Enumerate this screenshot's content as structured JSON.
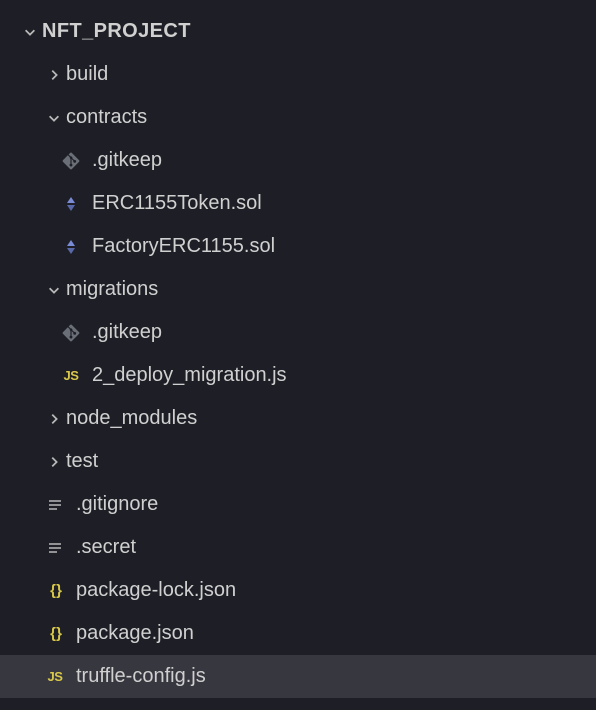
{
  "project": {
    "name": "NFT_PROJECT"
  },
  "tree": {
    "build": "build",
    "contracts": "contracts",
    "contracts_children": {
      "gitkeep": ".gitkeep",
      "erc1155": "ERC1155Token.sol",
      "factory": "FactoryERC1155.sol"
    },
    "migrations": "migrations",
    "migrations_children": {
      "gitkeep": ".gitkeep",
      "deploy": "2_deploy_migration.js"
    },
    "node_modules": "node_modules",
    "test": "test",
    "gitignore": ".gitignore",
    "secret": ".secret",
    "package_lock": "package-lock.json",
    "package": "package.json",
    "truffle": "truffle-config.js"
  }
}
